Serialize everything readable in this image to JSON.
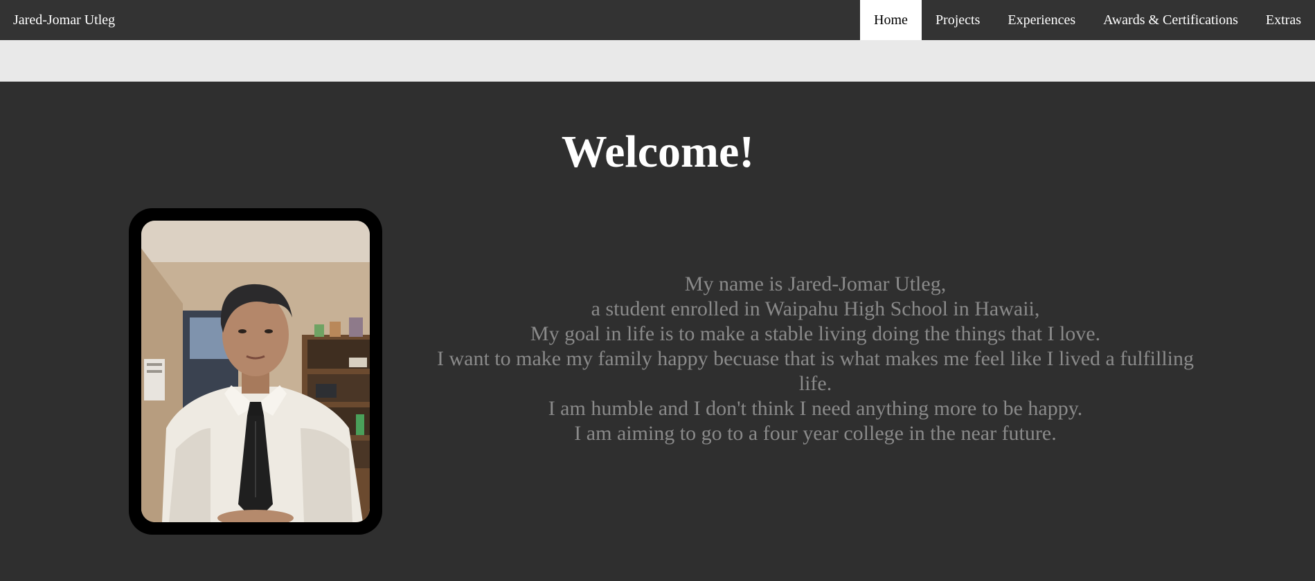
{
  "navbar": {
    "brand": "Jared-Jomar Utleg",
    "items": [
      {
        "label": "Home",
        "active": true
      },
      {
        "label": "Projects",
        "active": false
      },
      {
        "label": "Experiences",
        "active": false
      },
      {
        "label": "Awards & Certifications",
        "active": false
      },
      {
        "label": "Extras",
        "active": false
      }
    ]
  },
  "main": {
    "heading": "Welcome!",
    "bio_lines": [
      "My name is Jared-Jomar Utleg,",
      "a student enrolled in Waipahu High School in Hawaii,",
      "My goal in life is to make a stable living doing the things that I love.",
      "I want to make my family happy becuase that is what makes me feel like I lived a fulfilling life.",
      "I am humble and I don't think I need anything more to be happy.",
      "I am aiming to go to a four year college in the near future."
    ]
  },
  "colors": {
    "navbar_bg": "#333333",
    "active_tab_bg": "#ffffff",
    "subbar_bg": "#e9e9e9",
    "page_bg": "#2f2f2f",
    "bio_text": "#8a8a8a"
  }
}
